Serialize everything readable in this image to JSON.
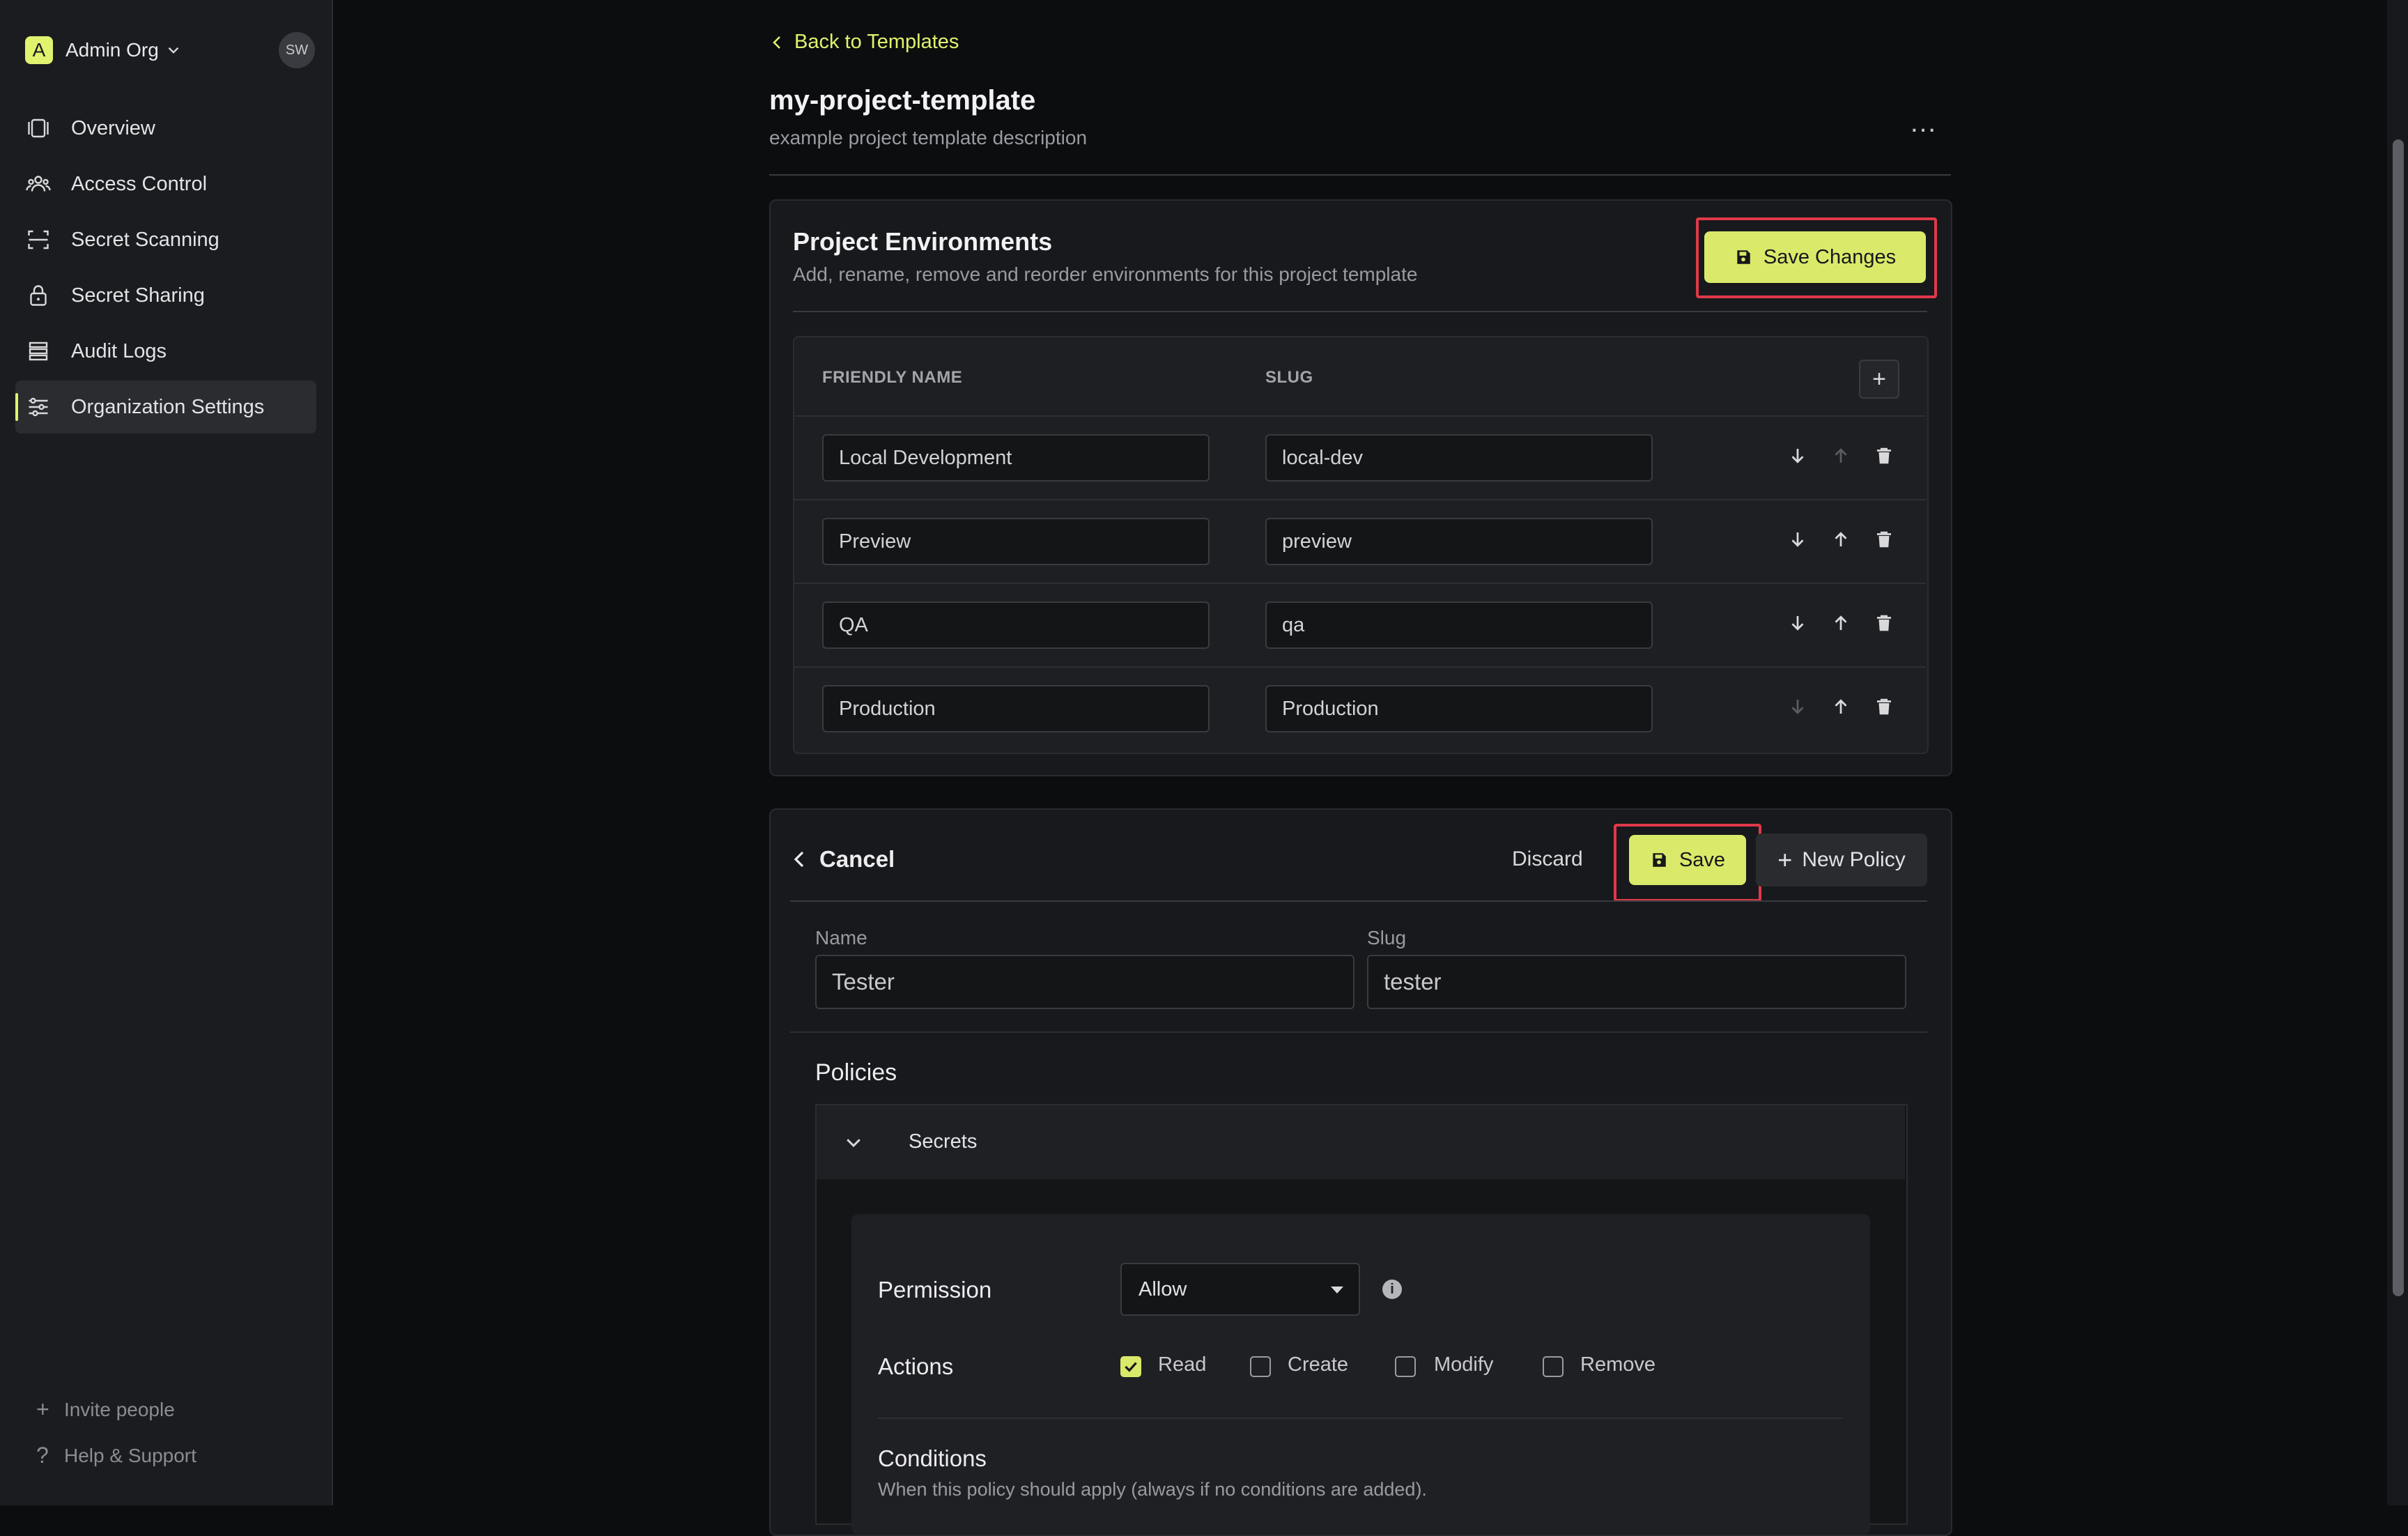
{
  "org": {
    "logo_letter": "A",
    "name": "Admin Org",
    "avatar": "SW"
  },
  "nav": [
    {
      "label": "Overview",
      "icon": "overview-icon"
    },
    {
      "label": "Access Control",
      "icon": "users-icon"
    },
    {
      "label": "Secret Scanning",
      "icon": "scan-icon"
    },
    {
      "label": "Secret Sharing",
      "icon": "lock-icon"
    },
    {
      "label": "Audit Logs",
      "icon": "list-icon"
    },
    {
      "label": "Organization Settings",
      "icon": "settings-sliders-icon",
      "active": true
    }
  ],
  "sidebar_footer": {
    "invite": "Invite people",
    "help": "Help & Support"
  },
  "header": {
    "back_label": "Back to Templates",
    "title": "my-project-template",
    "description": "example project template description"
  },
  "environments": {
    "title": "Project Environments",
    "description": "Add, rename, remove and reorder environments for this project template",
    "save_label": "Save Changes",
    "columns": [
      "FRIENDLY NAME",
      "SLUG"
    ],
    "rows": [
      {
        "name": "Local Development",
        "slug": "local-dev"
      },
      {
        "name": "Preview",
        "slug": "preview"
      },
      {
        "name": "QA",
        "slug": "qa"
      },
      {
        "name": "Production",
        "slug": "Production"
      }
    ]
  },
  "role": {
    "cancel_label": "Cancel",
    "discard_label": "Discard",
    "save_label": "Save",
    "new_policy_label": "New Policy",
    "name_label": "Name",
    "name_value": "Tester",
    "slug_label": "Slug",
    "slug_value": "tester",
    "policies_title": "Policies",
    "policy_section": "Secrets",
    "permission_label": "Permission",
    "permission_value": "Allow",
    "actions_label": "Actions",
    "actions": [
      {
        "label": "Read",
        "checked": true
      },
      {
        "label": "Create",
        "checked": false
      },
      {
        "label": "Modify",
        "checked": false
      },
      {
        "label": "Remove",
        "checked": false
      }
    ],
    "conditions_label": "Conditions",
    "conditions_desc": "When this policy should apply (always if no conditions are added)."
  },
  "colors": {
    "accent": "#dbe96b",
    "highlight": "#e0394a",
    "background": "#0c0d0f",
    "sidebar": "#1b1c1f"
  }
}
